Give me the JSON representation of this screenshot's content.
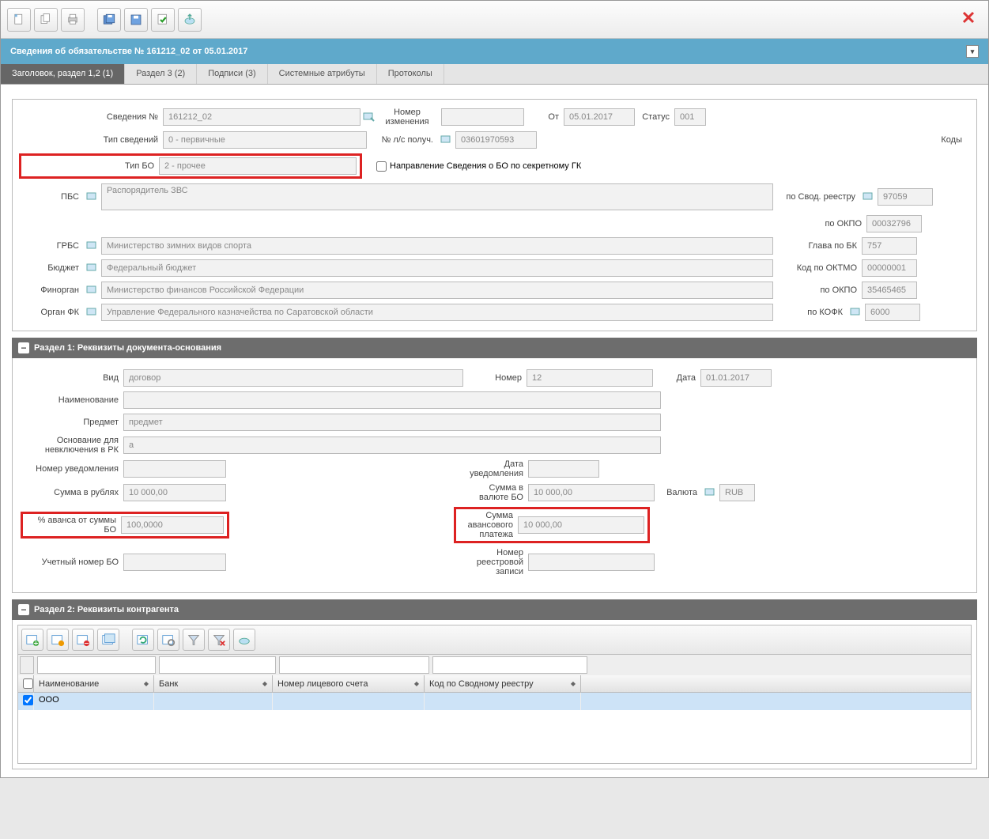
{
  "title": "Сведения об обязательстве № 161212_02 от 05.01.2017",
  "tabs": [
    "Заголовок, раздел 1,2 (1)",
    "Раздел 3 (2)",
    "Подписи (3)",
    "Системные атрибуты",
    "Протоколы"
  ],
  "header": {
    "svedeniya_no_lbl": "Сведения №",
    "svedeniya_no": "161212_02",
    "nomer_izm_lbl": "Номер изменения",
    "nomer_izm": "",
    "ot_lbl": "От",
    "ot": "05.01.2017",
    "status_lbl": "Статус",
    "status": "001",
    "tip_sved_lbl": "Тип сведений",
    "tip_sved": "0 - первичные",
    "ls_poluch_lbl": "№ л/с получ.",
    "ls_poluch": "03601970593",
    "tip_bo_lbl": "Тип БО",
    "tip_bo": "2 - прочее",
    "napr_chk_lbl": "Направление Сведения о БО по секретному ГК",
    "kody_lbl": "Коды",
    "pbs_lbl": "ПБС",
    "pbs": "Распорядитель ЗВС",
    "svod_reestr_lbl": "по Свод. реестру",
    "svod_reestr": "97059",
    "okpo1_lbl": "по ОКПО",
    "okpo1": "00032796",
    "grbs_lbl": "ГРБС",
    "grbs": "Министерство зимних видов спорта",
    "glava_bk_lbl": "Глава по БК",
    "glava_bk": "757",
    "budget_lbl": "Бюджет",
    "budget": "Федеральный бюджет",
    "oktmo_lbl": "Код по ОКТМО",
    "oktmo": "00000001",
    "finorgan_lbl": "Финорган",
    "finorgan": "Министерство финансов Российской Федерации",
    "okpo2_lbl": "по ОКПО",
    "okpo2": "35465465",
    "organ_fk_lbl": "Орган ФК",
    "organ_fk": "Управление Федерального казначейства по Саратовской области",
    "kofk_lbl": "по КОФК",
    "kofk": "6000"
  },
  "section1": {
    "title": "Раздел 1: Реквизиты документа-основания",
    "vid_lbl": "Вид",
    "vid": "договор",
    "nomer_lbl": "Номер",
    "nomer": "12",
    "data_lbl": "Дата",
    "data": "01.01.2017",
    "naim_lbl": "Наименование",
    "naim": "",
    "predmet_lbl": "Предмет",
    "predmet": "предмет",
    "osnov_lbl": "Основание для невключения в РК",
    "osnov": "а",
    "nomer_uved_lbl": "Номер уведомления",
    "nomer_uved": "",
    "data_uved_lbl": "Дата уведомления",
    "data_uved": "",
    "summa_rub_lbl": "Сумма в рублях",
    "summa_rub": "10 000,00",
    "summa_val_lbl": "Сумма в валюте БО",
    "summa_val": "10 000,00",
    "valuta_lbl": "Валюта",
    "valuta": "RUB",
    "avans_pct_lbl": "% аванса от суммы БО",
    "avans_pct": "100,0000",
    "summa_avans_lbl": "Сумма авансового платежа",
    "summa_avans": "10 000,00",
    "uchet_nomer_lbl": "Учетный номер БО",
    "uchet_nomer": "",
    "nomer_reestr_lbl": "Номер реестровой записи",
    "nomer_reestr": ""
  },
  "section2": {
    "title": "Раздел 2: Реквизиты контрагента",
    "cols": [
      "Наименование",
      "Банк",
      "Номер лицевого счета",
      "Код по Сводному реестру"
    ],
    "row": {
      "naim": "ООО",
      "bank": "",
      "ls": "",
      "kod": ""
    }
  }
}
